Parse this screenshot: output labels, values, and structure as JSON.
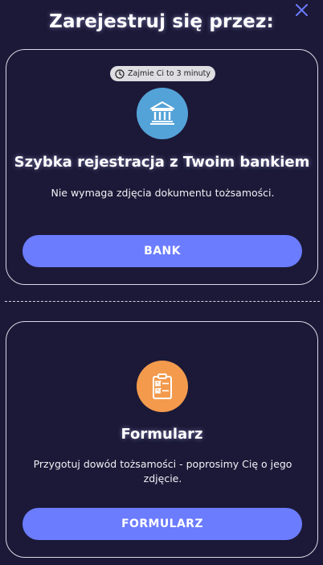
{
  "header": {
    "title": "Zarejestruj się przez:"
  },
  "close": {
    "icon": "close-icon"
  },
  "bank_card": {
    "badge_text": "Zajmie Ci to 3 minuty",
    "badge_icon": "clock-icon",
    "icon": "bank-icon",
    "icon_color": "#54a3d8",
    "title": "Szybka rejestracja z Twoim bankiem",
    "description": "Nie wymaga zdjęcia dokumentu tożsamości.",
    "button_label": "BANK"
  },
  "form_card": {
    "icon": "clipboard-checklist-icon",
    "icon_color": "#f39a4d",
    "title": "Formularz",
    "description": "Przygotuj dowód tożsamości - poprosimy Cię o jego zdjęcie.",
    "button_label": "FORMULARZ"
  },
  "colors": {
    "background": "#1b1937",
    "button": "#6b7cff",
    "close_icon": "#6b7cff"
  }
}
